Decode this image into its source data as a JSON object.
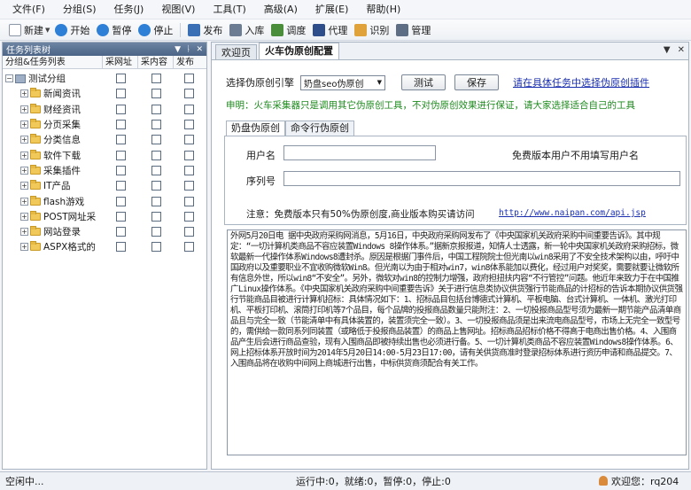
{
  "menu": [
    "文件(F)",
    "分组(S)",
    "任务(J)",
    "视图(V)",
    "工具(T)",
    "高级(A)",
    "扩展(E)",
    "帮助(H)"
  ],
  "toolbar": {
    "new_label": "新建",
    "start_label": "开始",
    "pause_label": "暂停",
    "stop_label": "停止",
    "publish_label": "发布",
    "import_label": "入库",
    "schedule_label": "调度",
    "proxy_label": "代理",
    "recognize_label": "识别",
    "manage_label": "管理"
  },
  "left_panel": {
    "title": "任务列表树",
    "columns": [
      "分组&任务列表",
      "采网址",
      "采内容",
      "发布"
    ],
    "root": "测试分组",
    "items": [
      "新闻资讯",
      "财经资讯",
      "分页采集",
      "分类信息",
      "软件下载",
      "采集插件",
      "IT产品",
      "flash游戏",
      "POST网址采",
      "网站登录",
      "ASPX格式的"
    ]
  },
  "doc_tabs": [
    "欢迎页",
    "火车伪原创配置"
  ],
  "config": {
    "select_label": "选择伪原创引擎",
    "select_value": "奶盘seo伪原创",
    "test_button": "测试",
    "save_button": "保存",
    "task_link": "请在具体任务中选择伪原创插件",
    "disclaimer": "申明：火车采集器只是调用其它伪原创工具，不对伪原创效果进行保证，请大家选择适合自己的工具",
    "subtabs": [
      "奶盘伪原创",
      "命令行伪原创"
    ],
    "username_label": "用户名",
    "username_value": "",
    "free_note": "免费版本用户不用填写用户名",
    "serial_label": "序列号",
    "serial_value": "",
    "notice": "注意：免费版本只有50%伪原创度,商业版本购买请访问",
    "api_link": "http://www.naipan.com/api.jsp"
  },
  "article_text": "外网5月20日电 据中央政府采购网消息，5月16日，中央政府采购网发布了《中央国家机关政府采购中间重要告诉》。其中规定：“一切计算机类商品不容应装置Windows 8操作体系。”据新京报报道，知情人士透露，新一轮中央国家机关政府采购招标，微软最新一代操作体系Windows8遭封杀。原因是根据门事件后，中国工程院院士但光南以win8采用了不安全技术架构以由，呼吁中国政府以及重要职业不宜收购微软Win8。但光南以为由于相对win7，win8体系能加以费化，经过用户对奖奖，需要就要让微软所有信息外世，所以win8“不安全”。另外，微软对win8的控制力增强，政府担扭扶内容“不行管控”问题。他近年来致力于在中国推广Linux操作体系。《中央国家机关政府采购中间重要告诉》关于进行信息类协议供货强行节能商品的计招标的告诉本期协议供货强行节能商品目被进行计算机招标：具体情况如下：1、招标品目包括台博德式计算机、平板电脑、台式计算机、一体机、激光打印机、平板打印机、滚筒打印机等7个品目，每个品牌的投报商品数量只能附注：2、一切投报商品型号须为最新一期节能产品清单商品且与完全一致（节能清单中有具体装置的，装置须完全一致）。3、一切投报商品须是出来流电商品型号，市场上无完全一致型号的，需供给一款同系列同装置（或略低于投报商品装置）的商品上售网址。招标商品招标价格不得高于电商出售价格。4、入围商品产生后会进行商品查验，现有入围商品即被持续出售也必须进行备。5、一切计算机类商品不容应装置Windows8操作体系。6、网上招标体系开放时间为2014年5月20日14:00-5月23日17:00，请有关供货商准时登录招标体系进行资历申请和商品提交。7、入围商品将在收购中间网上商城进行出售，中标供货商须配合有关工作。",
  "status": {
    "left": "空闲中...",
    "center": "运行中:0，就绪:0，暂停:0，停止:0",
    "user": "欢迎您：rq204"
  }
}
